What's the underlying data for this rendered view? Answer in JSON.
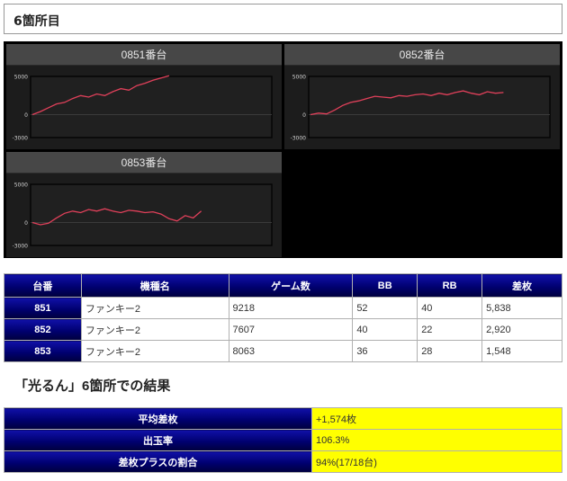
{
  "section_title": "6箇所目",
  "panels": [
    {
      "title": "0851番台",
      "y_ticks": [
        "5000",
        "0",
        "-3000"
      ],
      "values": [
        0,
        400,
        900,
        1400,
        1600,
        2100,
        2500,
        2300,
        2700,
        2500,
        3000,
        3400,
        3200,
        3800,
        4100,
        4500,
        4800,
        5100
      ]
    },
    {
      "title": "0852番台",
      "y_ticks": [
        "5000",
        "0",
        "-3000"
      ],
      "values": [
        0,
        200,
        100,
        600,
        1200,
        1600,
        1800,
        2100,
        2400,
        2300,
        2200,
        2500,
        2400,
        2600,
        2700,
        2500,
        2800,
        2600,
        2900,
        3100,
        2800,
        2600,
        3000,
        2800,
        2900
      ]
    },
    {
      "title": "0853番台",
      "y_ticks": [
        "5000",
        "0",
        "-3000"
      ],
      "values": [
        0,
        -300,
        -100,
        600,
        1200,
        1500,
        1300,
        1700,
        1500,
        1800,
        1500,
        1300,
        1600,
        1500,
        1300,
        1400,
        1100,
        500,
        200,
        900,
        600,
        1500
      ]
    }
  ],
  "table": {
    "headers": [
      "台番",
      "機種名",
      "ゲーム数",
      "BB",
      "RB",
      "差枚"
    ],
    "rows": [
      [
        "851",
        "ファンキー2",
        "9218",
        "52",
        "40",
        "5,838"
      ],
      [
        "852",
        "ファンキー2",
        "7607",
        "40",
        "22",
        "2,920"
      ],
      [
        "853",
        "ファンキー2",
        "8063",
        "36",
        "28",
        "1,548"
      ]
    ]
  },
  "result_title": "「光るん」6箇所での結果",
  "summary": [
    {
      "label": "平均差枚",
      "value": "+1,574枚"
    },
    {
      "label": "出玉率",
      "value": "106.3%"
    },
    {
      "label": "差枚プラスの割合",
      "value": "94%(17/18台)"
    }
  ],
  "colors": {
    "line": "#e0405a",
    "header_blue": "#000070",
    "highlight": "#ffff00"
  }
}
